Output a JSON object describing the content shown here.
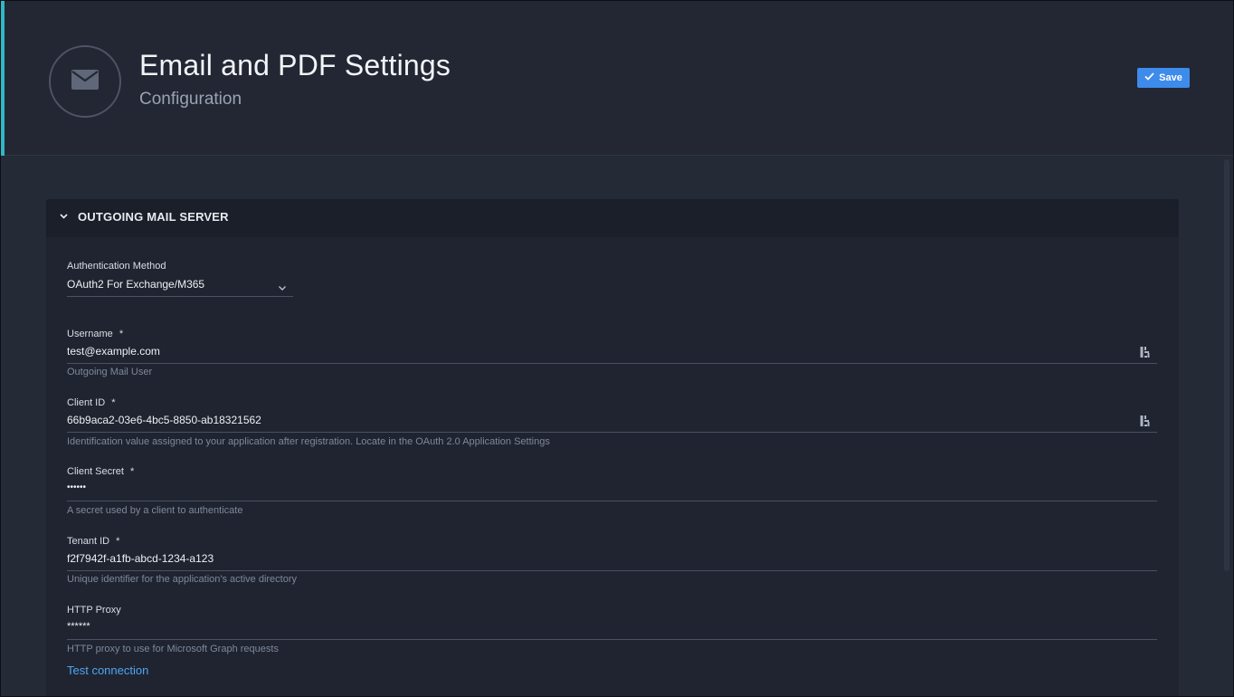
{
  "header": {
    "icon": "mail-icon",
    "title": "Email and PDF Settings",
    "subtitle": "Configuration",
    "save_label": "Save",
    "save_icon": "check-icon",
    "accent_color": "#2fb7c6",
    "button_color": "#3d8bea"
  },
  "section": {
    "title": "OUTGOING MAIL SERVER",
    "toggle_icon": "chevron-down-icon"
  },
  "fields": {
    "auth_method": {
      "label": "Authentication Method",
      "value": "OAuth2 For Exchange/M365"
    },
    "username": {
      "label": "Username",
      "required": "*",
      "value": "test@example.com",
      "help": "Outgoing Mail User"
    },
    "client_id": {
      "label": "Client ID",
      "required": "*",
      "value": "66b9aca2-03e6-4bc5-8850-ab18321562",
      "help": "Identification value assigned to your application after registration. Locate in the OAuth 2.0 Application Settings"
    },
    "client_secret": {
      "label": "Client Secret",
      "required": "*",
      "value": "••••••",
      "help": "A secret used by a client to authenticate"
    },
    "tenant_id": {
      "label": "Tenant ID",
      "required": "*",
      "value": "f2f7942f-a1fb-abcd-1234-a123",
      "help": "Unique identifier for the application's active directory"
    },
    "http_proxy": {
      "label": "HTTP Proxy",
      "value": "******",
      "help": "HTTP proxy to use for Microsoft Graph requests"
    }
  },
  "test_connection_label": "Test connection",
  "link_color": "#4fa6f3"
}
